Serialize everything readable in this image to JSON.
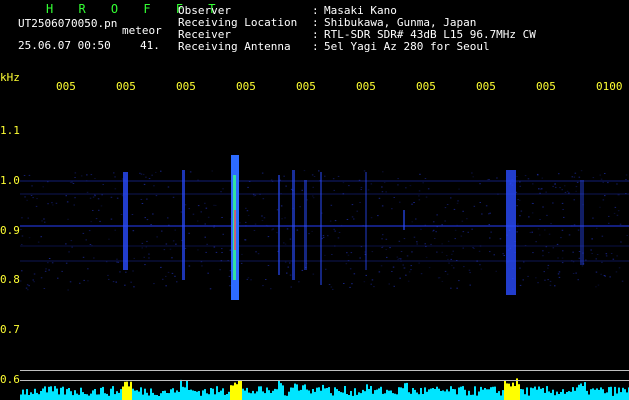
{
  "header": {
    "app_title": "H R O F F T",
    "filename": "UT2506070050.pn",
    "mode": "meteor",
    "timestamp": "25.06.07 00:50",
    "count": "41.",
    "info": [
      {
        "label": "Observer",
        "value": "Masaki Kano"
      },
      {
        "label": "Receiving Location",
        "value": "Shibukawa, Gunma, Japan"
      },
      {
        "label": "Receiver",
        "value": "RTL-SDR SDR# 43dB L15 96.7MHz CW"
      },
      {
        "label": "Receiving Antenna",
        "value": "5el Yagi Az 280 for Seoul"
      }
    ]
  },
  "axis": {
    "unit": "kHz",
    "time_ticks": [
      "005",
      "005",
      "005",
      "005",
      "005",
      "005",
      "005",
      "005",
      "005",
      "0100"
    ],
    "freq_ticks": [
      "1.1",
      "1.0",
      "0.9",
      "0.8",
      "0.7",
      "0.6"
    ]
  },
  "colors": {
    "header_title": "#33ff33",
    "axis_labels": "#ffff33",
    "info_text": "#ffffff",
    "spectrum_low": "#1a2aa8",
    "signal_bottom": "#00e5ff",
    "signal_peak": "#ffff00"
  }
}
